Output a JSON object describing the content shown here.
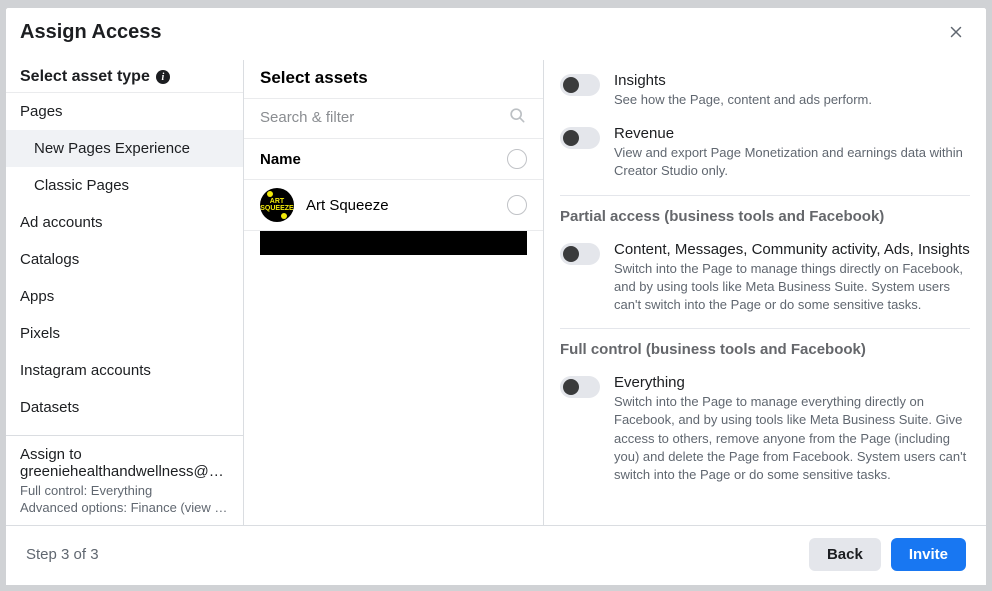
{
  "modal": {
    "title": "Assign Access",
    "step": "Step 3 of 3",
    "back": "Back",
    "invite": "Invite"
  },
  "left": {
    "sectionTitle": "Select asset type",
    "types": [
      {
        "label": "Pages"
      },
      {
        "label": "New Pages Experience",
        "sub": true,
        "selected": true
      },
      {
        "label": "Classic Pages",
        "sub": true
      },
      {
        "label": "Ad accounts"
      },
      {
        "label": "Catalogs"
      },
      {
        "label": "Apps"
      },
      {
        "label": "Pixels"
      },
      {
        "label": "Instagram accounts"
      },
      {
        "label": "Datasets"
      }
    ],
    "assign": {
      "label": "Assign to",
      "email": "greeniehealthandwellness@gmail.com",
      "line1": "Full control: Everything",
      "line2": "Advanced options: Finance (view an…"
    }
  },
  "mid": {
    "title": "Select assets",
    "searchPlaceholder": "Search & filter",
    "nameHeader": "Name",
    "assets": [
      {
        "name": "Art Squeeze",
        "avatarText": "ART SQUEEZE"
      }
    ]
  },
  "right": {
    "topPerms": [
      {
        "title": "Insights",
        "desc": "See how the Page, content and ads perform."
      },
      {
        "title": "Revenue",
        "desc": "View and export Page Monetization and earnings data within Creator Studio only."
      }
    ],
    "partial": {
      "head": "Partial access (business tools and Facebook)",
      "perm": {
        "title": "Content, Messages, Community activity, Ads, Insights",
        "desc": "Switch into the Page to manage things directly on Facebook, and by using tools like Meta Business Suite. System users can't switch into the Page or do some sensitive tasks."
      }
    },
    "full": {
      "head": "Full control (business tools and Facebook)",
      "perm": {
        "title": "Everything",
        "desc": "Switch into the Page to manage everything directly on Facebook, and by using tools like Meta Business Suite. Give access to others, remove anyone from the Page (including you) and delete the Page from Facebook. System users can't switch into the Page or do some sensitive tasks."
      }
    }
  }
}
